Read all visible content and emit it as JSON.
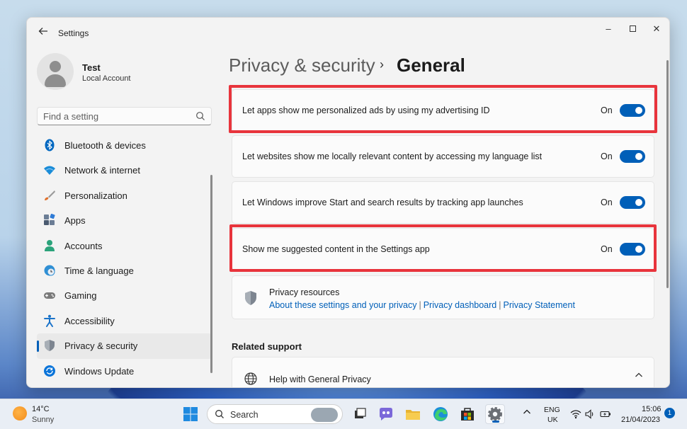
{
  "window": {
    "app_title": "Settings",
    "controls": {
      "minimize": "–",
      "close": "✕"
    }
  },
  "user": {
    "name": "Test",
    "account_type": "Local Account"
  },
  "search": {
    "placeholder": "Find a setting"
  },
  "sidebar": {
    "items": [
      {
        "label": "Bluetooth & devices",
        "icon": "bluetooth-icon",
        "color": "#0067c0"
      },
      {
        "label": "Network & internet",
        "icon": "wifi-icon",
        "color": "#1a8cd8"
      },
      {
        "label": "Personalization",
        "icon": "brush-icon",
        "color": "#e0702b"
      },
      {
        "label": "Apps",
        "icon": "apps-icon",
        "color": "#4a5a70"
      },
      {
        "label": "Accounts",
        "icon": "person-icon",
        "color": "#2ba37b"
      },
      {
        "label": "Time & language",
        "icon": "globe-clock-icon",
        "color": "#2f8fd4"
      },
      {
        "label": "Gaming",
        "icon": "gamepad-icon",
        "color": "#7a7a7a"
      },
      {
        "label": "Accessibility",
        "icon": "accessibility-icon",
        "color": "#1a73c9"
      },
      {
        "label": "Privacy & security",
        "icon": "shield-icon",
        "color": "#7d8590",
        "active": true
      },
      {
        "label": "Windows Update",
        "icon": "update-icon",
        "color": "#0a74d9"
      }
    ]
  },
  "breadcrumb": {
    "parent": "Privacy & security",
    "separator": "›",
    "current": "General"
  },
  "settings": [
    {
      "label": "Let apps show me personalized ads by using my advertising ID",
      "state": "On",
      "highlighted": true
    },
    {
      "label": "Let websites show me locally relevant content by accessing my language list",
      "state": "On",
      "highlighted": false
    },
    {
      "label": "Let Windows improve Start and search results by tracking app launches",
      "state": "On",
      "highlighted": false
    },
    {
      "label": "Show me suggested content in the Settings app",
      "state": "On",
      "highlighted": true
    }
  ],
  "privacy_resources": {
    "title": "Privacy resources",
    "links": [
      "About these settings and your privacy",
      "Privacy dashboard",
      "Privacy Statement"
    ]
  },
  "related_support": {
    "title": "Related support",
    "help_item": "Help with General Privacy"
  },
  "taskbar": {
    "weather": {
      "temp": "14°C",
      "desc": "Sunny"
    },
    "search_label": "Search",
    "lang": {
      "line1": "ENG",
      "line2": "UK"
    },
    "clock": {
      "time": "15:06",
      "date": "21/04/2023"
    },
    "notification_count": "1"
  },
  "colors": {
    "accent": "#005fb8",
    "highlight": "#e8343c"
  }
}
